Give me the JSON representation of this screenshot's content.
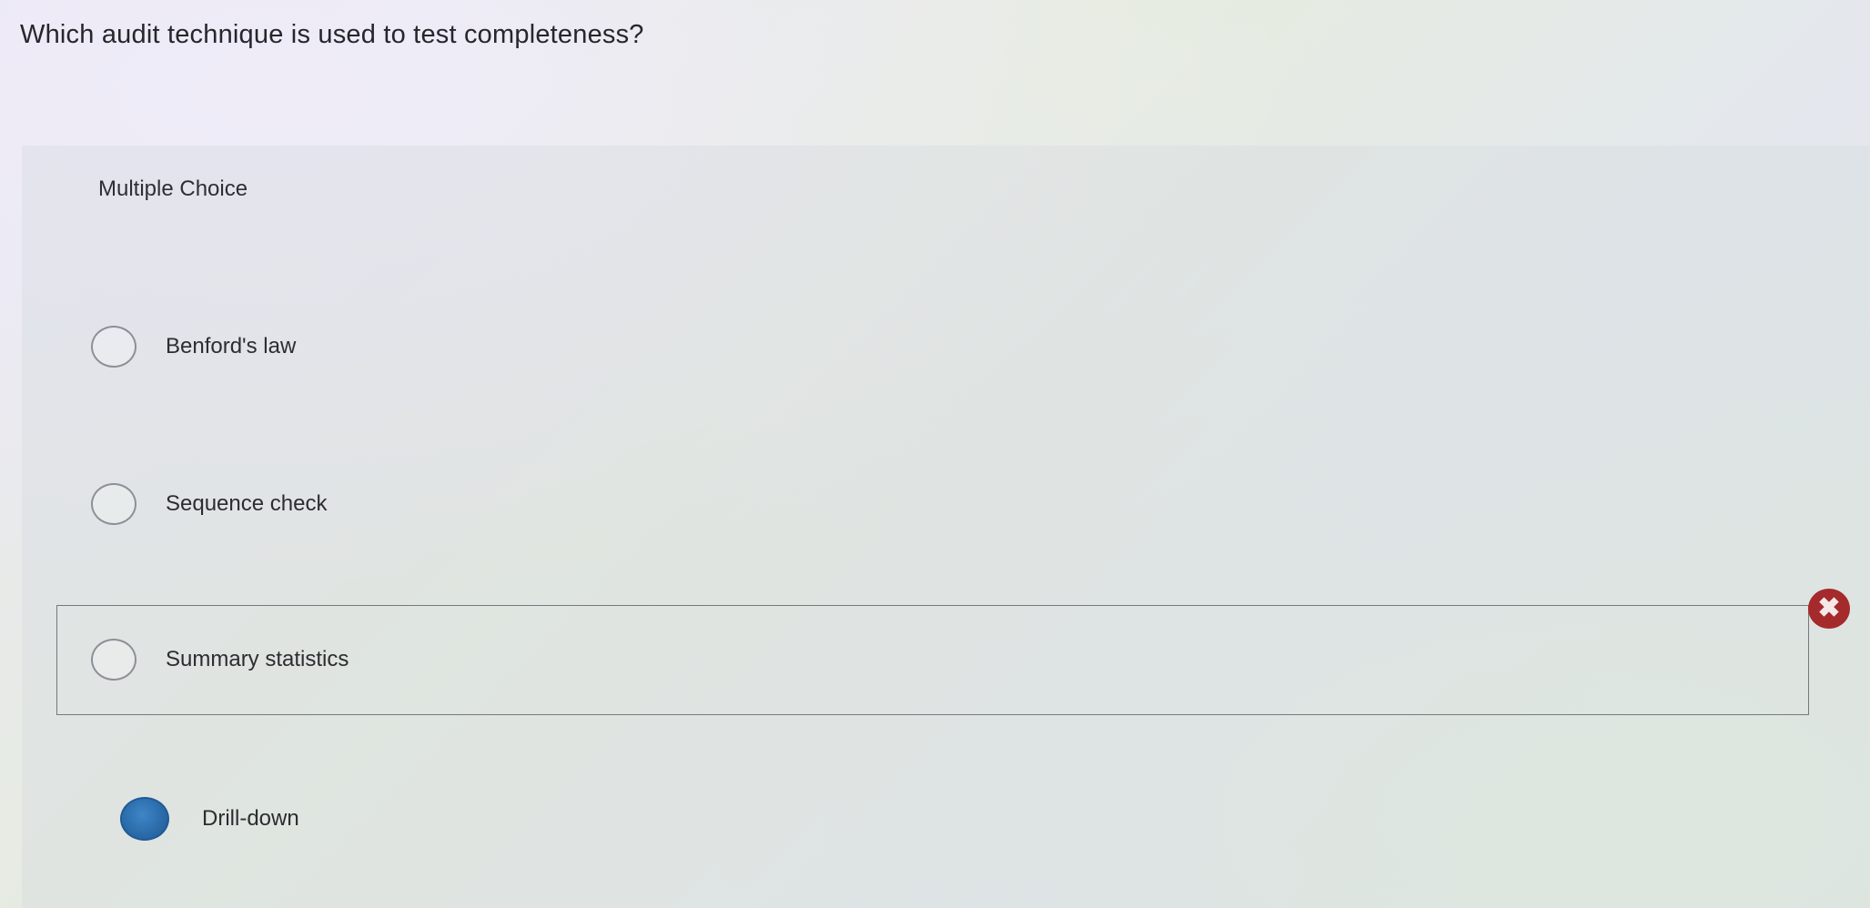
{
  "question": {
    "text": "Which audit technique is used to test completeness?"
  },
  "panel": {
    "type_label": "Multiple Choice"
  },
  "options": [
    {
      "label": "Benford's law",
      "selected": false
    },
    {
      "label": "Sequence check",
      "selected": false
    },
    {
      "label": "Summary statistics",
      "selected": false
    },
    {
      "label": "Drill-down",
      "selected": true
    }
  ],
  "feedback": {
    "icon": "x-mark-icon",
    "symbol": "✖",
    "status": "incorrect",
    "color": "#a52a2c"
  },
  "colors": {
    "selected_radio": "#2a6aa8"
  }
}
